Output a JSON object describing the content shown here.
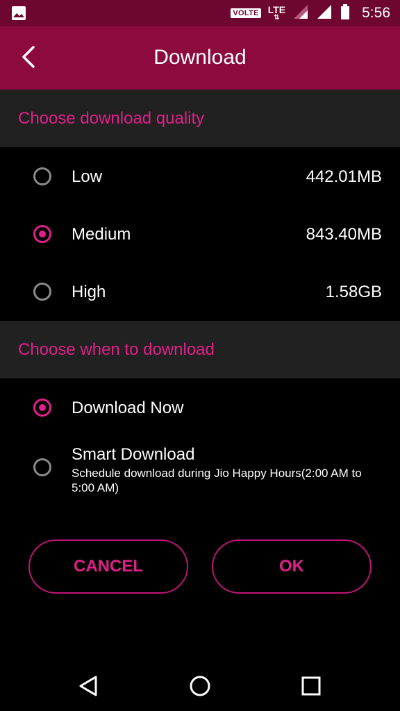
{
  "status_bar": {
    "volte": "VOLTE",
    "lte": "LTE",
    "time": "5:56"
  },
  "app_bar": {
    "title": "Download"
  },
  "quality_section": {
    "header": "Choose download quality",
    "options": [
      {
        "label": "Low",
        "size": "442.01MB",
        "selected": false
      },
      {
        "label": "Medium",
        "size": "843.40MB",
        "selected": true
      },
      {
        "label": "High",
        "size": "1.58GB",
        "selected": false
      }
    ]
  },
  "when_section": {
    "header": "Choose when to download",
    "options": [
      {
        "label": "Download Now",
        "selected": true
      },
      {
        "label": "Smart Download",
        "description": "Schedule download during Jio Happy Hours(2:00 AM to 5:00 AM)",
        "selected": false
      }
    ]
  },
  "buttons": {
    "cancel": "CANCEL",
    "ok": "OK"
  },
  "colors": {
    "accent": "#e0208a",
    "status_bar": "#6d0730",
    "app_bar": "#8c0a3d",
    "section_bg": "#212121"
  },
  "icons": {
    "back": "back-arrow-icon",
    "gallery": "image-icon",
    "battery": "battery-icon",
    "signal": "signal-icon",
    "nav_back": "nav-back-icon",
    "nav_home": "nav-home-icon",
    "nav_recents": "nav-recents-icon"
  }
}
